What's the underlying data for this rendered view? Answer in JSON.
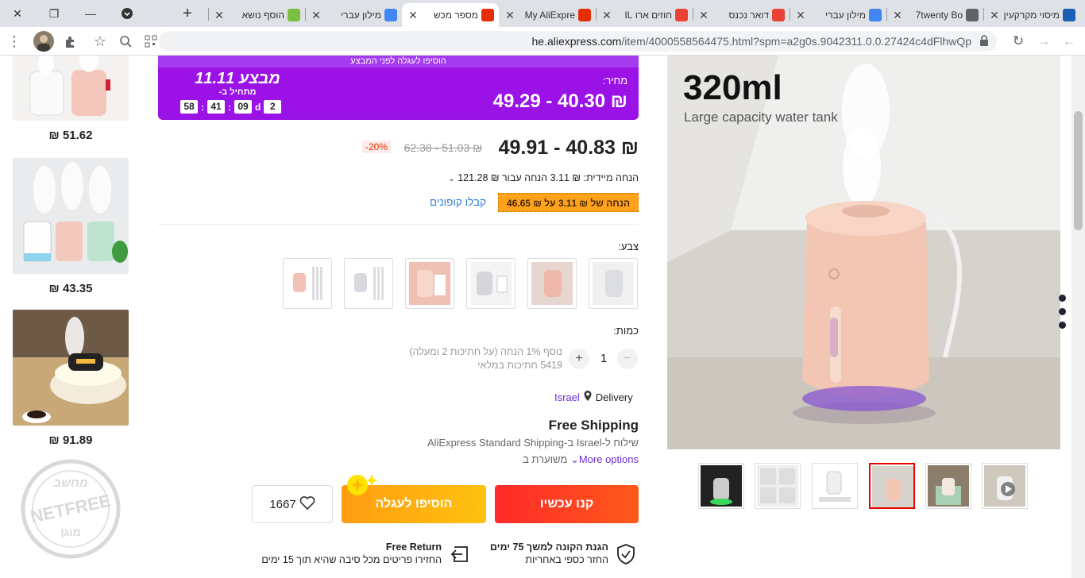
{
  "browser": {
    "tabs": [
      {
        "title": "מיסוי מקרקעין",
        "icon": "checkmark-icon",
        "color": "#1a5fb4"
      },
      {
        "title": "7twenty Bo",
        "icon": "globe-icon",
        "color": "#5f6368"
      },
      {
        "title": "מילון עברי",
        "icon": "google-icon",
        "color": "#4285f4"
      },
      {
        "title": "דואר נכנס",
        "icon": "gmail-icon",
        "color": "#ea4335"
      },
      {
        "title": "חוזים ארו IL",
        "icon": "gmail-icon",
        "color": "#ea4335"
      },
      {
        "title": "My AliExpre",
        "icon": "aliexpress-icon",
        "color": "#e62e04"
      },
      {
        "title": "מספר מכש",
        "icon": "aliexpress-icon",
        "color": "#e62e04"
      },
      {
        "title": "מילון עברי",
        "icon": "google-icon",
        "color": "#4285f4"
      },
      {
        "title": "הוסף נושא",
        "icon": "chat-icon",
        "color": "#7bc043"
      }
    ],
    "url_host": "he.aliexpress.com",
    "url_path": "/item/4000558564475.html?spm=a2g0s.9042311.0.0.27424c4dFlhwQp"
  },
  "recommendations": [
    {
      "price": "51.62 ₪"
    },
    {
      "price": "43.35 ₪"
    },
    {
      "price": "91.89 ₪"
    }
  ],
  "watermark": {
    "top": "מחשב",
    "middle": "NETFREE",
    "bottom": "מוגן"
  },
  "promo": {
    "banner": "הוסיפו לעגלה לפני המבצע",
    "price_label": "מחיר:",
    "price_range": "₪ 40.30 - 49.29",
    "sale_title": "מבצע 11.11",
    "starts_in": "מתחיל ב-",
    "countdown": {
      "days": "2",
      "d": "d",
      "hours": "09",
      "minutes": "41",
      "seconds": "58"
    }
  },
  "price": {
    "current": "₪ 40.83 - 49.91",
    "original": "₪ 51.03 - 62.38",
    "discount": "-20%",
    "instant_discount": "הנחה מיידית: ₪ 3.11 הנחה עבור ₪ 121.28",
    "coupon_badge": "הנחה של ₪ 3.11 על ₪ 46.65",
    "coupon_link": "קבלו קופונים"
  },
  "color": {
    "label": "צבע:"
  },
  "quantity": {
    "label": "כמות:",
    "value": "1",
    "minus": "−",
    "plus": "+",
    "extra_discount": "נוסף 1% הנחה (על חתיכות 2 ומעלה)",
    "stock": "5419 חתיכות במלאי"
  },
  "delivery": {
    "label": "Delivery",
    "country": "Israel",
    "free_shipping": "Free Shipping",
    "shipping_line": "שילוח ל-Israel ב-AliExpress Standard Shipping",
    "more_options": "More options",
    "estimated": "משוערת ב"
  },
  "actions": {
    "buy_now": "קנו עכשיו",
    "add_to_cart": "הוסיפו לעגלה",
    "wishlist_count": "1667"
  },
  "guarantees": {
    "protection_title": "הגנת הקונה למשך 75 ימים",
    "protection_sub": "החזר כספי באחריות",
    "return_title": "Free Return",
    "return_sub": "החזירו פריטים מכל סיבה שהיא תוך 15 ימים"
  },
  "gallery": {
    "title": "320ml",
    "subtitle": "Large capacity water tank"
  }
}
